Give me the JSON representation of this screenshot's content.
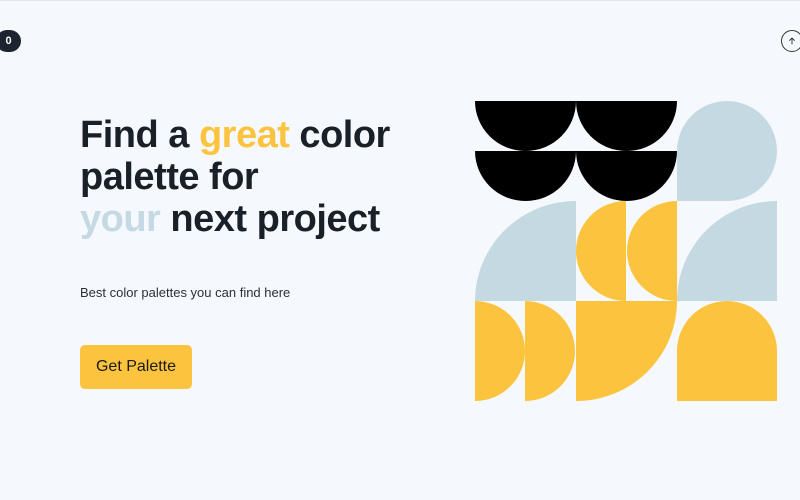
{
  "counter": "0",
  "hero": {
    "headline_part1": "Find a ",
    "headline_highlight1": "great",
    "headline_part2": " color",
    "headline_part3": "palette for",
    "headline_highlight2": "your",
    "headline_part4": " next project",
    "subtitle": "Best color palettes you can find here",
    "cta_label": "Get Palette"
  },
  "icons": {
    "scroll_top": "arrow-up-icon"
  },
  "colors": {
    "yellow": "#fcc33e",
    "light_blue": "#c5d9e2",
    "black": "#000000",
    "background": "#f5f9fd",
    "dark_text": "#1a2027"
  }
}
